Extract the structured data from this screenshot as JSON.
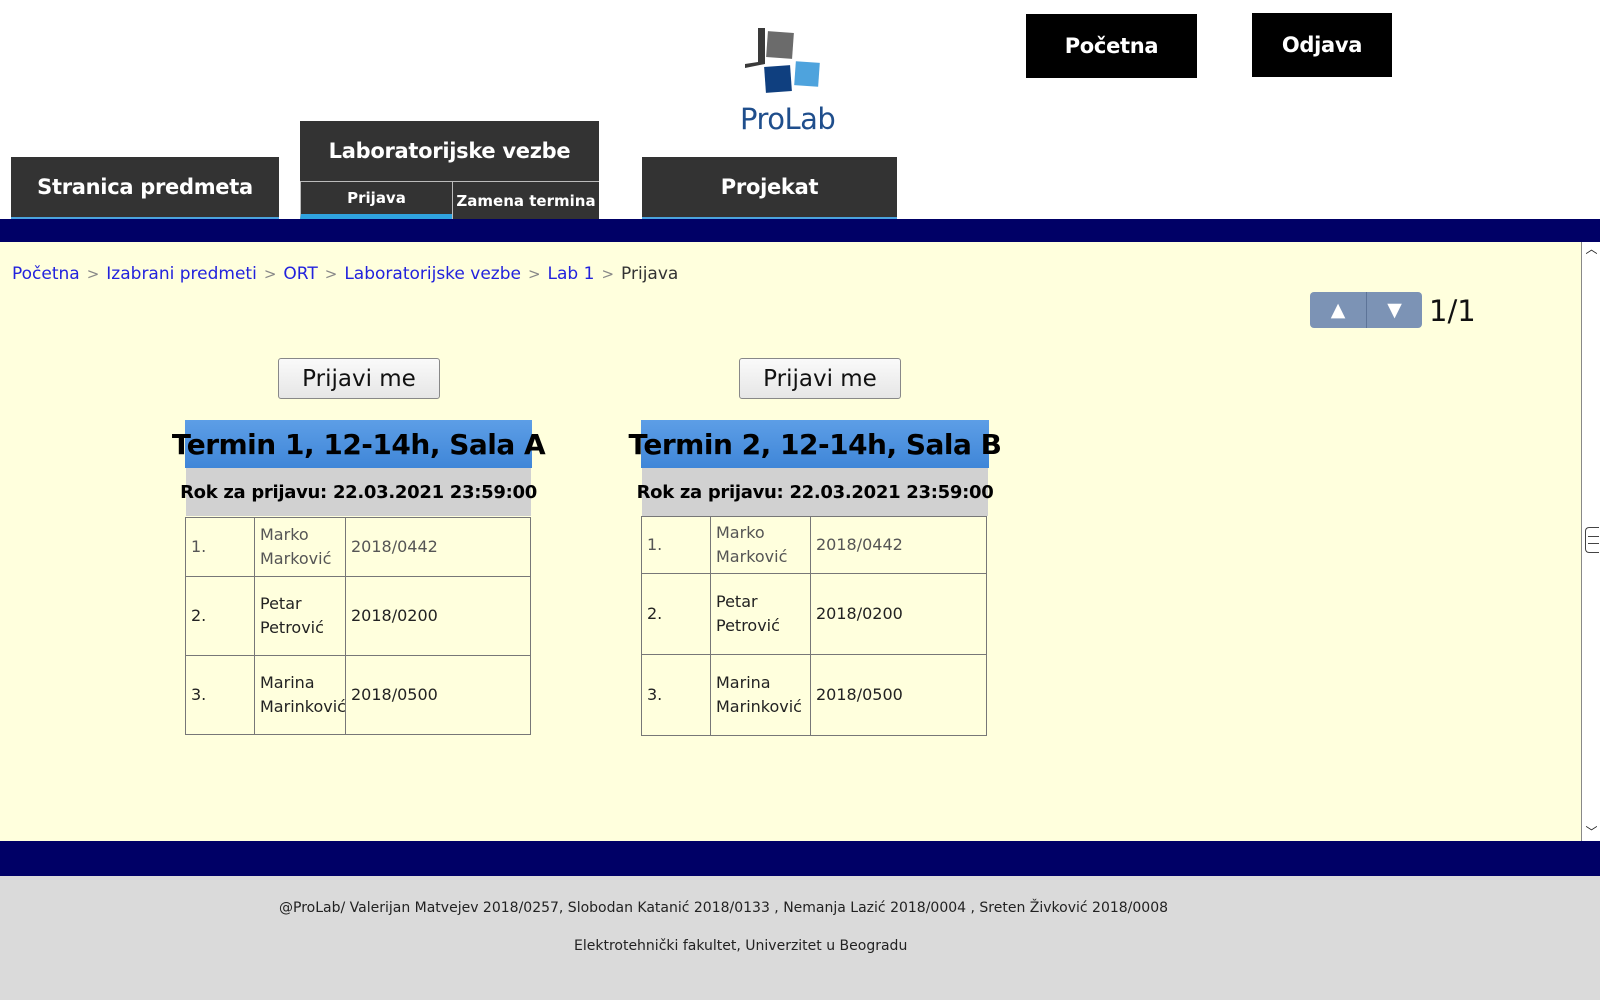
{
  "header": {
    "home_button": "Početna",
    "logout_button": "Odjava",
    "logo_text": "ProLab"
  },
  "tabs": {
    "course_page": "Stranica predmeta",
    "lab_exercises": "Laboratorijske vezbe",
    "lab_subtabs": [
      "Prijava",
      "Zamena termina"
    ],
    "project": "Projekat"
  },
  "breadcrumb": {
    "links": [
      "Početna",
      "Izabrani predmeti",
      "ORT",
      "Laboratorijske vezbe",
      "Lab 1"
    ],
    "separator": ">",
    "current": "Prijava"
  },
  "pager": {
    "up_icon": "▲",
    "down_icon": "▼",
    "page_label": "1/1"
  },
  "terms": [
    {
      "button_label": "Prijavi me",
      "title": "Termin 1, 12-14h, Sala A",
      "deadline_label": "Rok za prijavu:",
      "deadline_value": "22.03.2021 23:59:00",
      "students": [
        {
          "num": "1.",
          "first": "Marko",
          "last": "Marković",
          "index": "2018/0442"
        },
        {
          "num": "2.",
          "first": "Petar",
          "last": "Petrović",
          "index": "2018/0200"
        },
        {
          "num": "3.",
          "first": "Marina",
          "last": "Marinković",
          "index": "2018/0500"
        }
      ]
    },
    {
      "button_label": "Prijavi me",
      "title": "Termin 2, 12-14h, Sala B",
      "deadline_label": "Rok za prijavu:",
      "deadline_value": "22.03.2021 23:59:00",
      "students": [
        {
          "num": "1.",
          "first": "Marko",
          "last": "Marković",
          "index": "2018/0442"
        },
        {
          "num": "2.",
          "first": "Petar",
          "last": "Petrović",
          "index": "2018/0200"
        },
        {
          "num": "3.",
          "first": "Marina",
          "last": "Marinković",
          "index": "2018/0500"
        }
      ]
    }
  ],
  "footer": {
    "credits": "@ProLab/ Valerijan Matvejev 2018/0257, Slobodan Katanić 2018/0133 , Nemanja Lazić 2018/0004 , Sreten Živković 2018/0008",
    "institution": "Elektrotehnički fakultet, Univerzitet u Beogradu"
  },
  "colors": {
    "navy_bar": "#000066",
    "content_bg": "#ffffdd",
    "tab_bg": "#333333",
    "accent_blue": "#4aa3df",
    "term_header": "#4a90e2"
  }
}
